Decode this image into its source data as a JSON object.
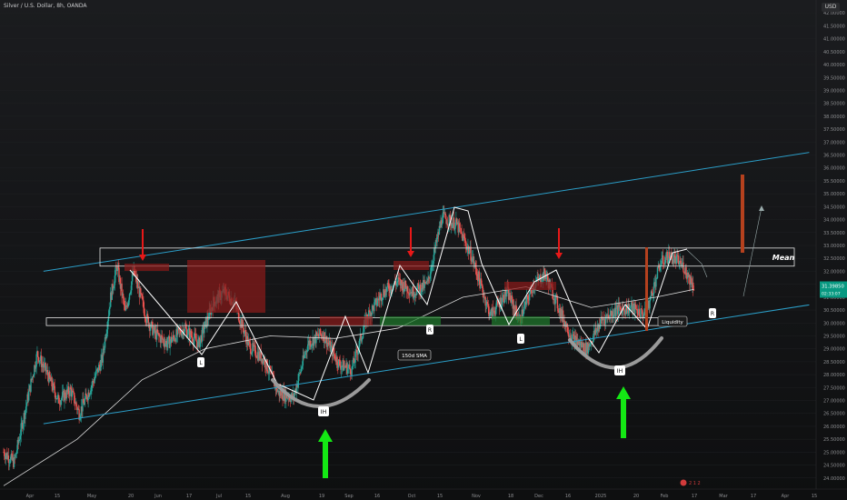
{
  "chart_data": {
    "type": "candlestick",
    "title": "Silver / U.S. Dollar, 8h, OANDA",
    "currency": "USD",
    "y_axis": {
      "ticks": [
        "24.00000",
        "24.50000",
        "25.00000",
        "25.50000",
        "26.00000",
        "26.50000",
        "27.00000",
        "27.50000",
        "28.00000",
        "28.50000",
        "29.00000",
        "29.50000",
        "30.00000",
        "30.50000",
        "31.00000",
        "31.50000",
        "32.00000",
        "32.50000",
        "33.00000",
        "33.50000",
        "34.00000",
        "34.50000",
        "35.00000",
        "35.50000",
        "36.00000",
        "36.50000",
        "37.00000",
        "37.50000",
        "38.00000",
        "38.50000",
        "39.00000",
        "39.50000",
        "40.00000",
        "40.50000",
        "41.00000",
        "41.50000",
        "42.00000"
      ],
      "range": [
        23.5,
        42.5
      ]
    },
    "x_axis": {
      "ticks": [
        "Apr",
        "15",
        "May",
        "20",
        "Jun",
        "17",
        "Jul",
        "15",
        "Aug",
        "19",
        "Sep",
        "16",
        "Oct",
        "15",
        "Nov",
        "18",
        "Dec",
        "16",
        "2025",
        "20",
        "Feb",
        "17",
        "Mar",
        "17",
        "Apr",
        "15"
      ]
    },
    "price_label": "31.39850",
    "price_sub": "02:33:07",
    "price_color": "#089981",
    "candle_up_color": "#26a69a",
    "candle_down_color": "#ef5350",
    "close_path": [
      {
        "date": "2024-03-27",
        "value": 25.0
      },
      {
        "date": "2024-04-01",
        "value": 24.6
      },
      {
        "date": "2024-04-08",
        "value": 27.3
      },
      {
        "date": "2024-04-12",
        "value": 28.8
      },
      {
        "date": "2024-04-17",
        "value": 28.0
      },
      {
        "date": "2024-04-22",
        "value": 27.0
      },
      {
        "date": "2024-04-28",
        "value": 27.4
      },
      {
        "date": "2024-05-02",
        "value": 26.5
      },
      {
        "date": "2024-05-08",
        "value": 27.6
      },
      {
        "date": "2024-05-13",
        "value": 28.6
      },
      {
        "date": "2024-05-17",
        "value": 31.0
      },
      {
        "date": "2024-05-20",
        "value": 32.2
      },
      {
        "date": "2024-05-24",
        "value": 30.4
      },
      {
        "date": "2024-05-28",
        "value": 32.0
      },
      {
        "date": "2024-06-03",
        "value": 30.2
      },
      {
        "date": "2024-06-07",
        "value": 29.6
      },
      {
        "date": "2024-06-13",
        "value": 29.2
      },
      {
        "date": "2024-06-17",
        "value": 29.5
      },
      {
        "date": "2024-06-21",
        "value": 29.8
      },
      {
        "date": "2024-06-28",
        "value": 29.2
      },
      {
        "date": "2024-07-05",
        "value": 30.8
      },
      {
        "date": "2024-07-10",
        "value": 31.2
      },
      {
        "date": "2024-07-15",
        "value": 30.8
      },
      {
        "date": "2024-07-22",
        "value": 29.1
      },
      {
        "date": "2024-07-29",
        "value": 28.6
      },
      {
        "date": "2024-08-05",
        "value": 27.3
      },
      {
        "date": "2024-08-12",
        "value": 27.1
      },
      {
        "date": "2024-08-19",
        "value": 29.2
      },
      {
        "date": "2024-08-26",
        "value": 29.6
      },
      {
        "date": "2024-09-03",
        "value": 28.4
      },
      {
        "date": "2024-09-09",
        "value": 28.2
      },
      {
        "date": "2024-09-16",
        "value": 30.2
      },
      {
        "date": "2024-09-24",
        "value": 31.2
      },
      {
        "date": "2024-10-01",
        "value": 31.6
      },
      {
        "date": "2024-10-08",
        "value": 31.2
      },
      {
        "date": "2024-10-15",
        "value": 31.5
      },
      {
        "date": "2024-10-22",
        "value": 34.1
      },
      {
        "date": "2024-10-29",
        "value": 33.8
      },
      {
        "date": "2024-11-05",
        "value": 32.6
      },
      {
        "date": "2024-11-14",
        "value": 30.3
      },
      {
        "date": "2024-11-22",
        "value": 31.2
      },
      {
        "date": "2024-11-28",
        "value": 30.1
      },
      {
        "date": "2024-12-04",
        "value": 31.4
      },
      {
        "date": "2024-12-10",
        "value": 31.9
      },
      {
        "date": "2024-12-17",
        "value": 30.5
      },
      {
        "date": "2024-12-23",
        "value": 29.4
      },
      {
        "date": "2024-12-30",
        "value": 29.0
      },
      {
        "date": "2025-01-06",
        "value": 30.1
      },
      {
        "date": "2025-01-13",
        "value": 30.5
      },
      {
        "date": "2025-01-20",
        "value": 30.6
      },
      {
        "date": "2025-01-27",
        "value": 30.3
      },
      {
        "date": "2025-02-03",
        "value": 32.3
      },
      {
        "date": "2025-02-07",
        "value": 32.6
      },
      {
        "date": "2025-02-11",
        "value": 32.4
      },
      {
        "date": "2025-02-14",
        "value": 32.2
      },
      {
        "date": "2025-02-19",
        "value": 31.4
      }
    ],
    "sma_150_path": [
      {
        "date": "2024-03-27",
        "value": 23.7
      },
      {
        "date": "2024-05-01",
        "value": 25.5
      },
      {
        "date": "2024-06-01",
        "value": 27.8
      },
      {
        "date": "2024-07-01",
        "value": 29.0
      },
      {
        "date": "2024-08-01",
        "value": 29.5
      },
      {
        "date": "2024-09-01",
        "value": 29.4
      },
      {
        "date": "2024-10-01",
        "value": 29.8
      },
      {
        "date": "2024-11-01",
        "value": 31.0
      },
      {
        "date": "2024-12-01",
        "value": 31.4
      },
      {
        "date": "2025-01-01",
        "value": 30.6
      },
      {
        "date": "2025-02-01",
        "value": 31.0
      },
      {
        "date": "2025-02-19",
        "value": 31.3
      }
    ],
    "annotations": {
      "labels": {
        "mean": "Mean",
        "liquidity": "Liquidity",
        "sma": "150d SMA",
        "ih": "IH",
        "l": "L",
        "r": "R",
        "flag": "2 1 2"
      },
      "channel_upper": [
        {
          "date": "2024-04-15",
          "value": 32.0
        },
        {
          "date": "2025-04-15",
          "value": 36.6
        }
      ],
      "channel_lower": [
        {
          "date": "2024-04-15",
          "value": 26.1
        },
        {
          "date": "2025-04-15",
          "value": 30.7
        }
      ],
      "mean_zone": [
        32.2,
        32.9
      ],
      "liquidity_zone": [
        29.9,
        30.2
      ],
      "colors": {
        "channel": "#2b9ec8",
        "pattern": "#ffffff",
        "red_arrow": "#e81818",
        "green_arrow": "#14e814",
        "projection": "#b5411e",
        "supply_zone": "#8b1a1a",
        "demand_zone": "#1f7a2c",
        "arc": "#9a9a9a"
      }
    }
  }
}
